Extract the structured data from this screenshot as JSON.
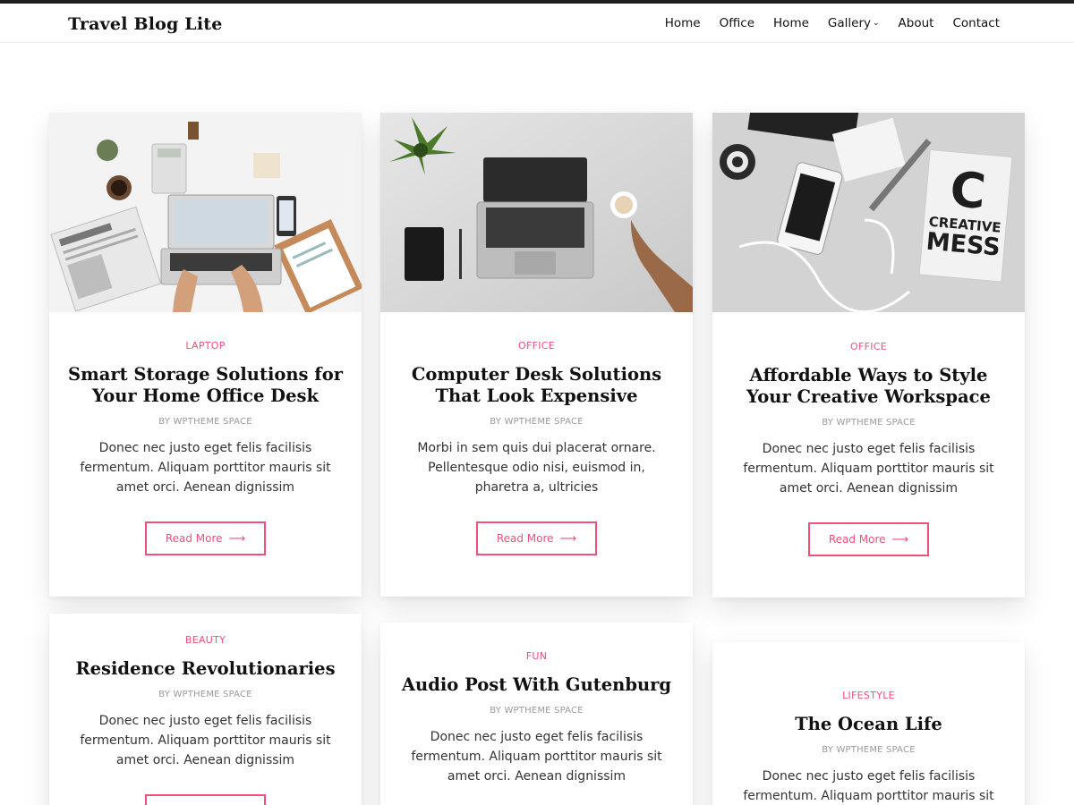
{
  "header": {
    "logo": "Travel Blog Lite",
    "nav": [
      {
        "label": "Home"
      },
      {
        "label": "Office"
      },
      {
        "label": "Home"
      },
      {
        "label": "Gallery",
        "has_dropdown": true
      },
      {
        "label": "About"
      },
      {
        "label": "Contact"
      }
    ]
  },
  "colors": {
    "accent": "#f0517a",
    "text": "#111111",
    "muted": "#9a9a9a",
    "topbar": "#1f1f1f"
  },
  "posts": [
    {
      "category": "LAPTOP",
      "title": "Smart Storage Solutions for Your Home Office Desk",
      "author": "BY WPTHEME SPACE",
      "excerpt": "Donec nec justo eget felis facilisis fermentum. Aliquam porttitor mauris sit amet orci. Aenean dignissim",
      "read_more": "Read More",
      "image": "laptop-desk-photo"
    },
    {
      "category": "OFFICE",
      "title": "Computer Desk Solutions That Look Expensive",
      "author": "BY WPTHEME SPACE",
      "excerpt": "Morbi in sem quis dui placerat ornare. Pellentesque odio nisi, euismod in, pharetra a, ultricies",
      "read_more": "Read More",
      "image": "laptop-coffee-photo"
    },
    {
      "category": "OFFICE",
      "title": "Affordable Ways to Style Your Creative Workspace",
      "author": "BY WPTHEME SPACE",
      "excerpt": "Donec nec justo eget felis facilisis fermentum. Aliquam porttitor mauris sit amet orci. Aenean dignissim",
      "read_more": "Read More",
      "image": "creative-mess-photo",
      "image_text": [
        "C",
        "CREATIVE",
        "MESS"
      ]
    },
    {
      "category": "BEAUTY",
      "title": "Residence Revolutionaries",
      "author": "BY WPTHEME SPACE",
      "excerpt": "Donec nec justo eget felis facilisis fermentum. Aliquam porttitor mauris sit amet orci. Aenean dignissim"
    },
    {
      "category": "FUN",
      "title": "Audio Post With Gutenburg",
      "author": "BY WPTHEME SPACE",
      "excerpt": "Donec nec justo eget felis facilisis fermentum. Aliquam porttitor mauris sit amet orci. Aenean dignissim"
    },
    {
      "category": "LIFESTYLE",
      "title": "The Ocean Life",
      "author": "BY WPTHEME SPACE",
      "excerpt": "Donec nec justo eget felis facilisis fermentum. Aliquam porttitor mauris sit amet orci. Aenean"
    }
  ]
}
